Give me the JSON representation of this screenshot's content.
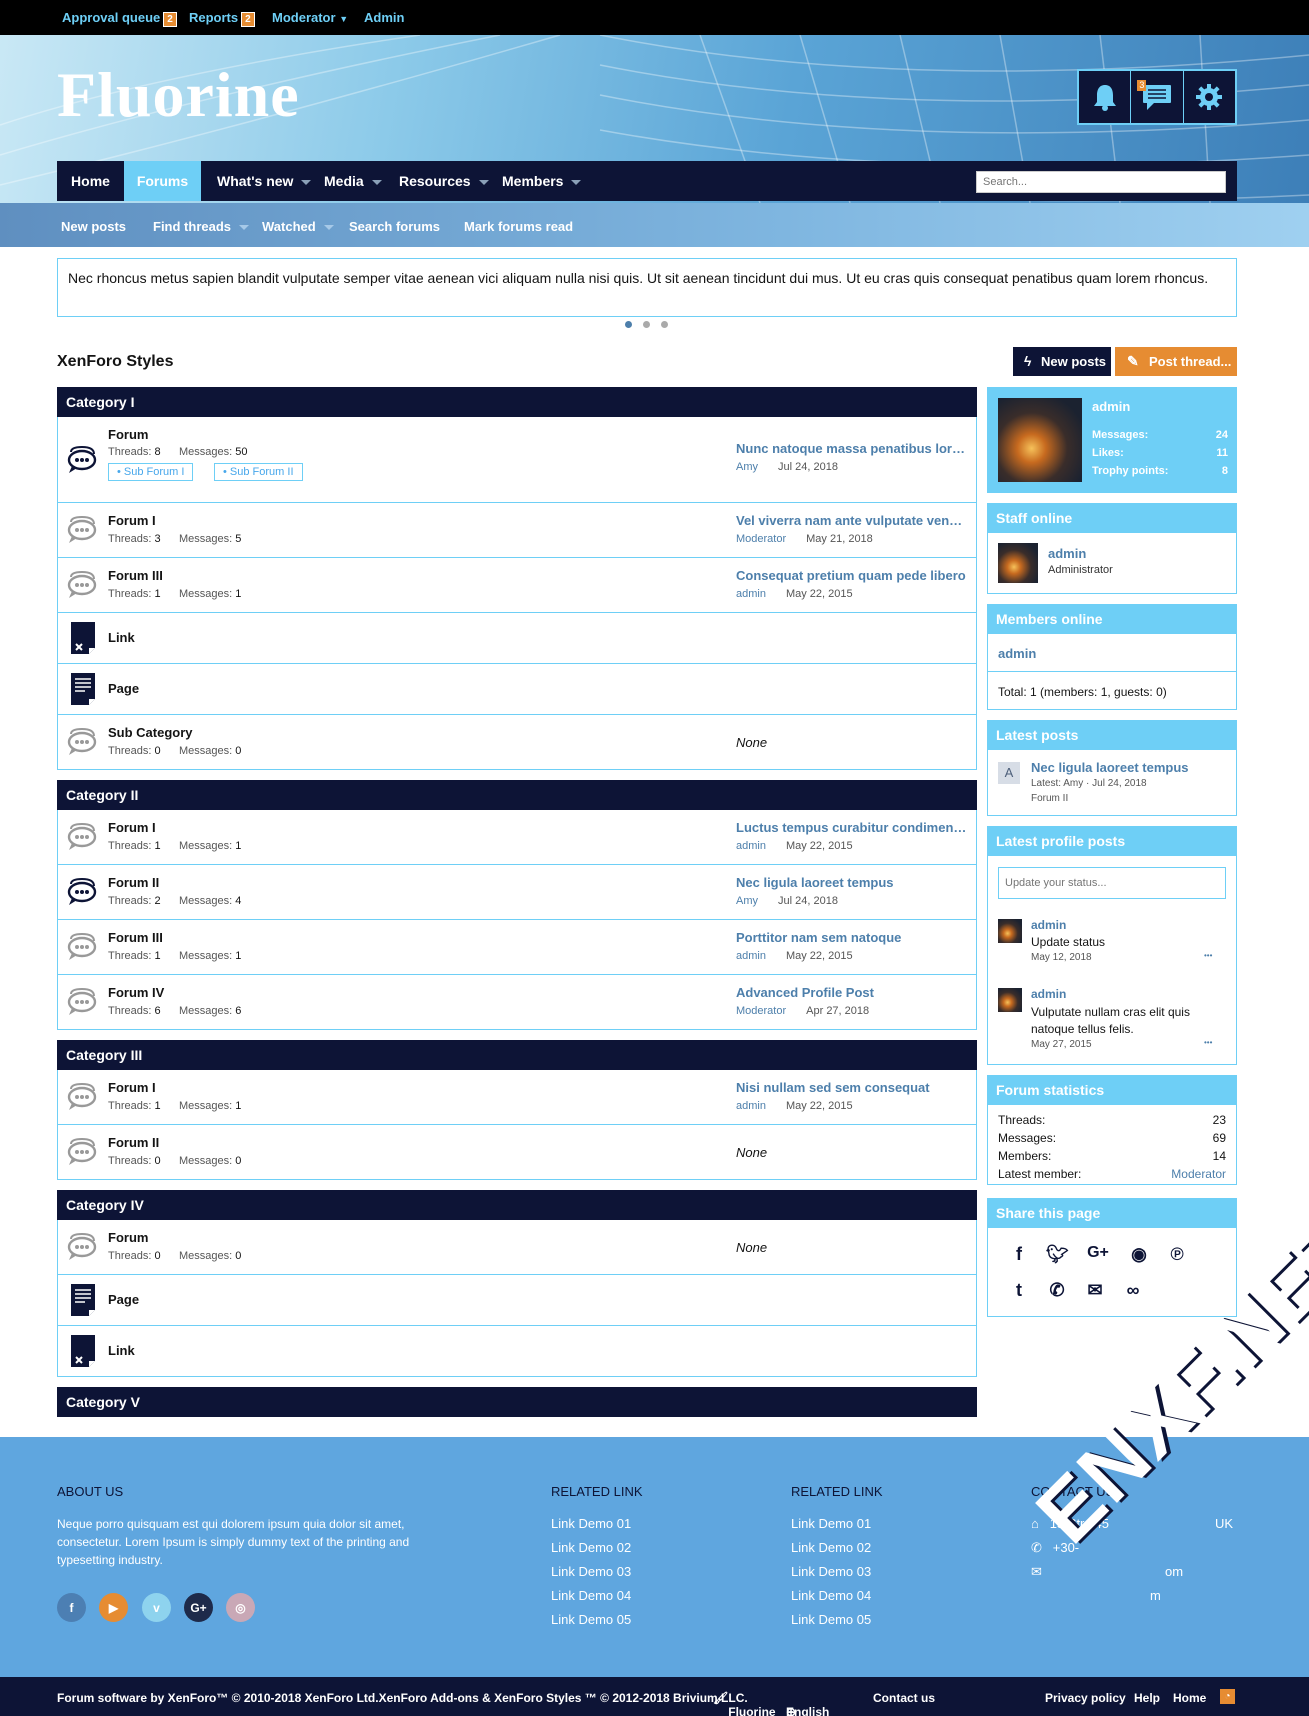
{
  "staffbar": {
    "approval": "Approval queue",
    "approval_count": "2",
    "reports": "Reports",
    "reports_count": "2",
    "moderator": "Moderator",
    "admin": "Admin"
  },
  "header": {
    "logo": "Fluorine",
    "conv_count": "3"
  },
  "nav": {
    "tabs": [
      "Home",
      "Forums",
      "What's new",
      "Media",
      "Resources",
      "Members"
    ],
    "search_placeholder": "Search..."
  },
  "subnav": [
    "New posts",
    "Find threads",
    "Watched",
    "Search forums",
    "Mark forums read"
  ],
  "notice": "Nec rhoncus metus sapien blandit vulputate semper vitae aenean vici aliquam nulla nisi quis. Ut sit aenean tincidunt dui mus. Ut eu cras quis consequat penatibus quam lorem rhoncus.",
  "page": {
    "title": "XenForo Styles",
    "new_posts": "New posts",
    "post_thread": "Post thread..."
  },
  "labels": {
    "threads": "Threads:",
    "messages": "Messages:"
  },
  "cats": {
    "c1": {
      "title": "Category I",
      "n1": {
        "title": "Forum",
        "t": "8",
        "m": "50",
        "lt": "Nunc natoque massa penatibus lorem",
        "lu": "Amy",
        "ld": "Jul 24, 2018",
        "s1": "Sub Forum I",
        "s2": "Sub Forum II"
      },
      "n2": {
        "title": "Forum I",
        "t": "3",
        "m": "5",
        "lt": "Vel viverra nam ante vulputate venen...",
        "lu": "Moderator",
        "ld": "May 21, 2018"
      },
      "n3": {
        "title": "Forum III",
        "t": "1",
        "m": "1",
        "lt": "Consequat pretium quam pede libero",
        "lu": "admin",
        "ld": "May 22, 2015"
      },
      "n4": {
        "title": "Link"
      },
      "n5": {
        "title": "Page"
      },
      "n6": {
        "title": "Sub Category",
        "t": "0",
        "m": "0",
        "none": "None"
      }
    },
    "c2": {
      "title": "Category II",
      "n1": {
        "title": "Forum I",
        "t": "1",
        "m": "1",
        "lt": "Luctus tempus curabitur condimentum",
        "lu": "admin",
        "ld": "May 22, 2015"
      },
      "n2": {
        "title": "Forum II",
        "t": "2",
        "m": "4",
        "lt": "Nec ligula laoreet tempus",
        "lu": "Amy",
        "ld": "Jul 24, 2018"
      },
      "n3": {
        "title": "Forum III",
        "t": "1",
        "m": "1",
        "lt": "Porttitor nam sem natoque",
        "lu": "admin",
        "ld": "May 22, 2015"
      },
      "n4": {
        "title": "Forum IV",
        "t": "6",
        "m": "6",
        "lt": "Advanced Profile Post",
        "lu": "Moderator",
        "ld": "Apr 27, 2018"
      }
    },
    "c3": {
      "title": "Category III",
      "n1": {
        "title": "Forum I",
        "t": "1",
        "m": "1",
        "lt": "Nisi nullam sed sem consequat",
        "lu": "admin",
        "ld": "May 22, 2015"
      },
      "n2": {
        "title": "Forum II",
        "t": "0",
        "m": "0",
        "none": "None"
      }
    },
    "c4": {
      "title": "Category IV",
      "n1": {
        "title": "Forum",
        "t": "0",
        "m": "0",
        "none": "None"
      },
      "n2": {
        "title": "Page"
      },
      "n3": {
        "title": "Link"
      }
    },
    "c5": {
      "title": "Category V"
    }
  },
  "sidebar": {
    "user": {
      "name": "admin",
      "messages_label": "Messages:",
      "messages": "24",
      "likes_label": "Likes:",
      "likes": "11",
      "trophy_label": "Trophy points:",
      "trophy": "8"
    },
    "staff": {
      "title": "Staff online",
      "name": "admin",
      "role": "Administrator"
    },
    "members": {
      "title": "Members online",
      "name": "admin",
      "total": "Total: 1 (members: 1, guests: 0)"
    },
    "latest": {
      "title": "Latest posts",
      "avatar": "A",
      "post": "Nec ligula laoreet tempus",
      "meta": "Latest: Amy · Jul 24, 2018",
      "forum": "Forum II"
    },
    "profile": {
      "title": "Latest profile posts",
      "placeholder": "Update your status...",
      "p1_user": "admin",
      "p1_text": "Update status",
      "p1_date": "May 12, 2018",
      "p2_user": "admin",
      "p2_text": "Vulputate nullam cras elit quis natoque tellus felis.",
      "p2_date": "May 27, 2015",
      "more": "•••"
    },
    "stats": {
      "title": "Forum statistics",
      "threads_l": "Threads:",
      "threads": "23",
      "messages_l": "Messages:",
      "messages": "69",
      "members_l": "Members:",
      "members": "14",
      "latest_l": "Latest member:",
      "latest": "Moderator"
    },
    "share": {
      "title": "Share this page"
    }
  },
  "footer": {
    "about_title": "ABOUT US",
    "about_text": "Neque porro quisquam est qui dolorem ipsum quia dolor sit amet, consectetur. Lorem Ipsum is simply dummy text of the printing and typesetting industry.",
    "rel1_title": "RELATED LINK",
    "rel2_title": "RELATED LINK",
    "links": [
      "Link Demo 01",
      "Link Demo 02",
      "Link Demo 03",
      "Link Demo 04",
      "Link Demo 05"
    ],
    "contact_title": "CONTACT US",
    "contact_addr": "15 Str., 45",
    "contact_addr2": "UK",
    "contact_phone": "+30-",
    "contact_mail1": "om",
    "contact_mail2": "m"
  },
  "copyright": {
    "text": "Forum software by XenForo™ © 2010-2018 XenForo Ltd.XenForo Add-ons & XenForo Styles ™ © 2012-2018 Brivium LLC.",
    "style": "Fluorine",
    "lang": "English (US)",
    "contact": "Contact us",
    "privacy": "Privacy policy",
    "help": "Help",
    "home": "Home"
  },
  "watermark": "ENXF.NET",
  "colors": {
    "navy": "#0d1436",
    "accent": "#6ecff6",
    "link": "#4d7fab",
    "orange": "#e68c32"
  }
}
